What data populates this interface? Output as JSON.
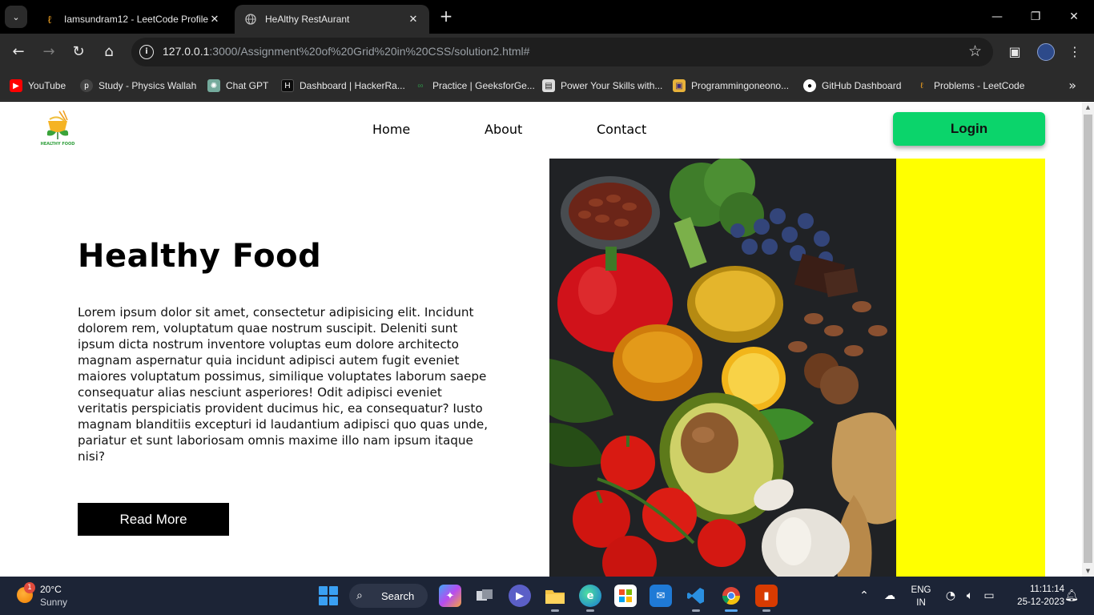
{
  "browser": {
    "tabs": [
      {
        "title": "Iamsundram12 - LeetCode Profile",
        "active": false
      },
      {
        "title": "HeAlthy RestAurant",
        "active": true
      }
    ],
    "address": {
      "host": "127.0.0.1",
      "path": ":3000/Assignment%20of%20Grid%20in%20CSS/solution2.html#"
    },
    "bookmarks": [
      {
        "label": "YouTube",
        "icon": "youtube-icon",
        "color": "#ff0000"
      },
      {
        "label": "Study - Physics Wallah",
        "icon": "physics-wallah-icon",
        "color": "#444444"
      },
      {
        "label": "Chat GPT",
        "icon": "chatgpt-icon",
        "color": "#74aa9c"
      },
      {
        "label": "Dashboard | HackerRa...",
        "icon": "hackerrank-icon",
        "color": "#0b0b0b"
      },
      {
        "label": "Practice | GeeksforGe...",
        "icon": "geeksforgeeks-icon",
        "color": "#2f8d46"
      },
      {
        "label": "Power Your Skills with...",
        "icon": "skills-icon",
        "color": "#dddddd"
      },
      {
        "label": "Programmingoneono...",
        "icon": "programming-icon",
        "color": "#e8b23a"
      },
      {
        "label": "GitHub Dashboard",
        "icon": "github-icon",
        "color": "#ffffff"
      },
      {
        "label": "Problems - LeetCode",
        "icon": "leetcode-icon",
        "color": "#f0a020"
      }
    ]
  },
  "page": {
    "logo_text": "HEALTHY FOOD",
    "nav": [
      {
        "label": "Home"
      },
      {
        "label": "About"
      },
      {
        "label": "Contact"
      }
    ],
    "login_label": "Login",
    "hero": {
      "title": "Healthy Food",
      "body": "Lorem ipsum dolor sit amet, consectetur adipisicing elit. Incidunt dolorem rem, voluptatum quae nostrum suscipit. Deleniti sunt ipsum dicta nostrum inventore voluptas eum dolore architecto magnam aspernatur quia incidunt adipisci autem fugit eveniet maiores voluptatum possimus, similique voluptates laborum saepe consequatur alias nesciunt asperiores! Odit adipisci eveniet veritatis perspiciatis provident ducimus hic, ea consequatur? Iusto magnam blanditiis excepturi id laudantium adipisci quo quas unde, pariatur et sunt laboriosam omnis maxime illo nam ipsum itaque nisi?",
      "button_label": "Read More"
    },
    "colors": {
      "login_bg": "#0bd46b",
      "side_panel": "#ffff00",
      "read_more_bg": "#000000"
    }
  },
  "taskbar": {
    "weather": {
      "temp": "20°C",
      "condition": "Sunny",
      "badge": "1"
    },
    "search_label": "Search",
    "apps": [
      "copilot-icon",
      "task-view-icon",
      "teams-chat-icon",
      "file-explorer-icon",
      "edge-icon",
      "store-icon",
      "mail-icon",
      "vscode-icon",
      "chrome-icon",
      "office-icon"
    ],
    "language": {
      "line1": "ENG",
      "line2": "IN"
    },
    "clock": {
      "time": "11:11:14",
      "date": "25-12-2023"
    }
  }
}
